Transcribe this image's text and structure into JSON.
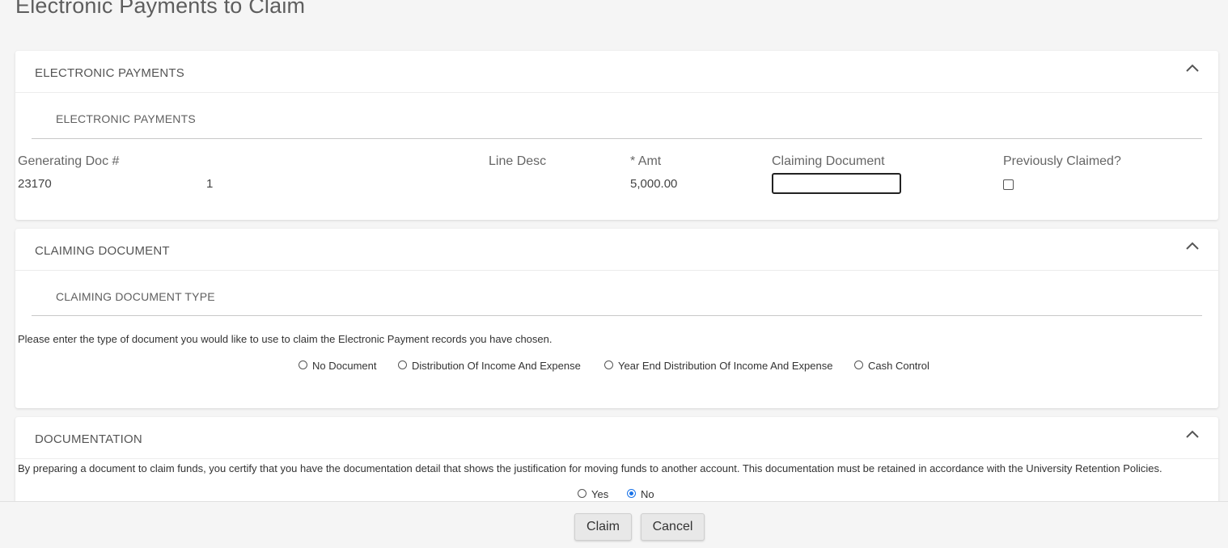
{
  "page": {
    "title": "Electronic Payments to Claim"
  },
  "electronic_payments": {
    "header": "ELECTRONIC PAYMENTS",
    "subheader": "ELECTRONIC PAYMENTS",
    "columns": {
      "generating_doc": "Generating Doc #",
      "line_desc": "Line Desc",
      "amt": "* Amt",
      "claiming_document": "Claiming Document",
      "previously_claimed": "Previously Claimed?"
    },
    "row": {
      "generating_doc": "23170",
      "line": "1",
      "line_desc": "",
      "amt": "5,000.00",
      "claiming_document": "",
      "previously_claimed": false
    }
  },
  "claiming_document": {
    "header": "CLAIMING DOCUMENT",
    "subheader": "CLAIMING DOCUMENT TYPE",
    "instruction": "Please enter the type of document you would like to use to claim the Electronic Payment records you have chosen.",
    "options": [
      {
        "label": "No Document",
        "selected": false
      },
      {
        "label": "Distribution Of Income And Expense",
        "selected": false
      },
      {
        "label": "Year End Distribution Of Income And Expense",
        "selected": false
      },
      {
        "label": "Cash Control",
        "selected": false
      }
    ]
  },
  "documentation": {
    "header": "DOCUMENTATION",
    "statement": "By preparing a document to claim funds, you certify that you have the documentation detail that shows the justification for moving funds to another account. This documentation must be retained in accordance with the University Retention Policies.",
    "options": [
      {
        "label": "Yes",
        "selected": false
      },
      {
        "label": "No",
        "selected": true
      }
    ]
  },
  "footer": {
    "claim_label": "Claim",
    "cancel_label": "Cancel"
  },
  "colors": {
    "accent": "#1a73e8",
    "background": "#f5f5f5"
  }
}
